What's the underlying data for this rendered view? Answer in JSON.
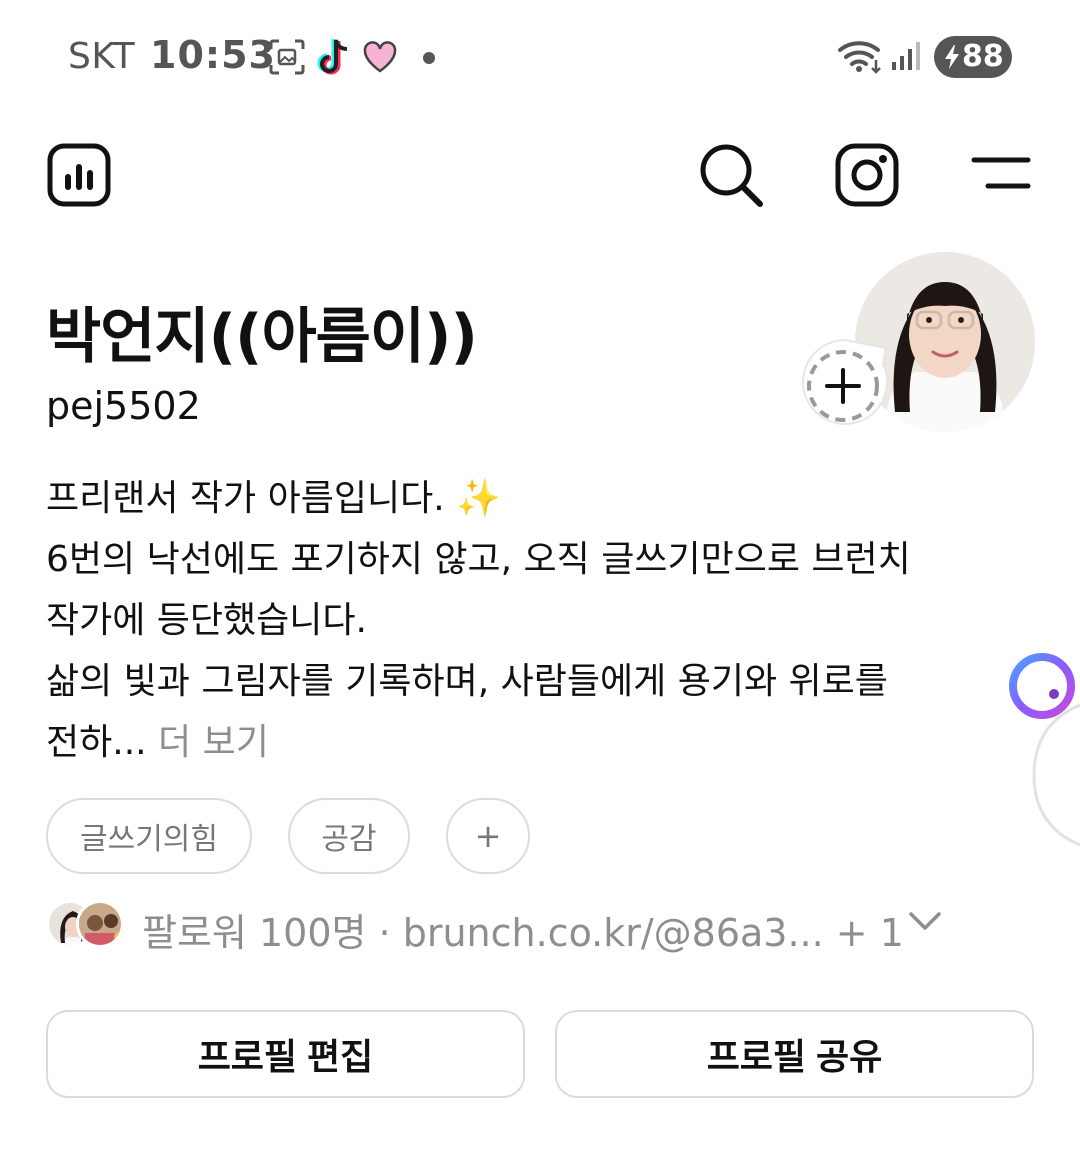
{
  "status_bar": {
    "carrier": "SKT",
    "time": "10:53",
    "battery": "88",
    "icons": [
      "screenshot-icon",
      "tiktok-icon",
      "heart-icon",
      "notification-dot",
      "wifi-icon",
      "signal-icon",
      "battery-charging-icon"
    ]
  },
  "toolbar": {
    "left_icon": "insights-icon",
    "right_icons": [
      "search-icon",
      "instagram-icon",
      "menu-icon"
    ]
  },
  "profile": {
    "display_name": "박언지((아름이))",
    "username": "pej5502",
    "bio_lines": [
      "프리랜서 작가 아름입니다. ✨",
      "6번의 낙선에도 포기하지 않고, 오직 글쓰기만으로 브런치",
      "작가에 등단했습니다.",
      "삶의 빛과 그림자를 기록하며, 사람들에게 용기와 위로를",
      "전하"
    ],
    "bio_ellipsis": "...",
    "bio_more": " 더 보기"
  },
  "chips": [
    "글쓰기의힘",
    "공감",
    "+"
  ],
  "followers": {
    "text": "팔로워 100명",
    "separator": " · ",
    "link": "brunch.co.kr/@86a3...",
    "extra": " + 1"
  },
  "buttons": {
    "edit_profile": "프로필 편집",
    "share_profile": "프로필 공유"
  },
  "colors": {
    "text": "#111111",
    "secondary": "#8e8e8e",
    "border": "#dbdbdb",
    "status": "#555555"
  }
}
